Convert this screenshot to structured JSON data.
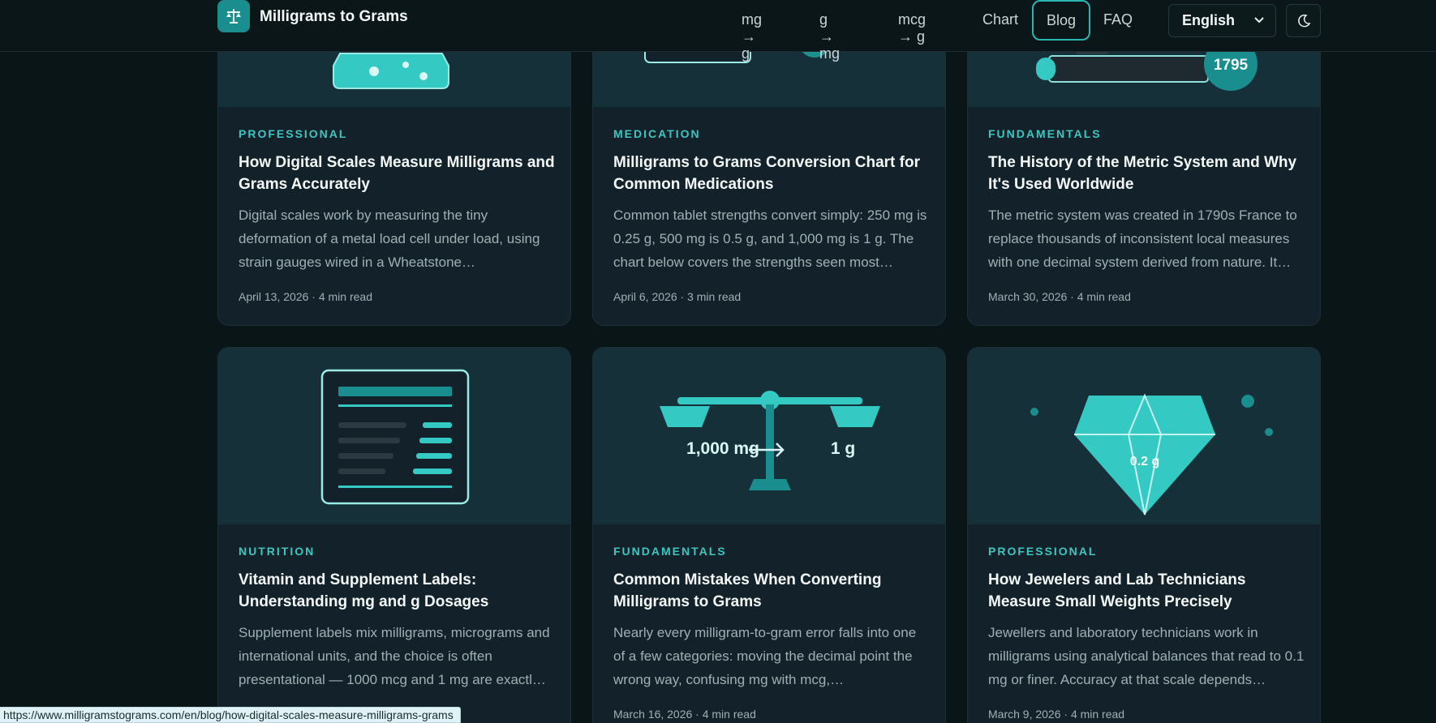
{
  "header": {
    "brand": "Milligrams to Grams",
    "nav": [
      {
        "label": "mg → g"
      },
      {
        "label": "g → mg"
      },
      {
        "label": "mcg → g"
      },
      {
        "label": "Chart"
      },
      {
        "label": "Blog"
      },
      {
        "label": "FAQ"
      }
    ],
    "language": "English",
    "logo_icon": "scale-icon",
    "theme_icon": "moon-icon"
  },
  "cards": [
    {
      "category": "PROFESSIONAL",
      "title": "How Digital Scales Measure Milligrams and Grams Accurately",
      "excerpt": "Digital scales work by measuring the tiny deformation of a metal load cell under load, using strain gauges wired in a Wheatstone…",
      "meta": "April 13, 2026 · 4 min read"
    },
    {
      "category": "MEDICATION",
      "title": "Milligrams to Grams Conversion Chart for Common Medications",
      "excerpt": "Common tablet strengths convert simply: 250 mg is 0.25 g, 500 mg is 0.5 g, and 1,000 mg is 1 g. The chart below covers the strengths seen most…",
      "meta": "April 6, 2026 · 3 min read"
    },
    {
      "category": "FUNDAMENTALS",
      "title": "The History of the Metric System and Why It's Used Worldwide",
      "excerpt": "The metric system was created in 1790s France to replace thousands of inconsistent local measures with one decimal system derived from nature. It…",
      "meta": "March 30, 2026 · 4 min read",
      "image_label": "1795"
    },
    {
      "category": "NUTRITION",
      "title": "Vitamin and Supplement Labels: Understanding mg and g Dosages",
      "excerpt": "Supplement labels mix milligrams, micrograms and international units, and the choice is often presentational — 1000 mcg and 1 mg are exactl…",
      "meta": ""
    },
    {
      "category": "FUNDAMENTALS",
      "title": "Common Mistakes When Converting Milligrams to Grams",
      "excerpt": "Nearly every milligram-to-gram error falls into one of a few categories: moving the decimal point the wrong way, confusing mg with mcg,…",
      "meta": "March 16, 2026 · 4 min read",
      "image_left": "1,000 mg",
      "image_right": "1 g"
    },
    {
      "category": "PROFESSIONAL",
      "title": "How Jewelers and Lab Technicians Measure Small Weights Precisely",
      "excerpt": "Jewellers and laboratory technicians work in milligrams using analytical balances that read to 0.1 mg or finer. Accuracy at that scale depends…",
      "meta": "March 9, 2026 · 4 min read",
      "image_label": "0.2 g"
    }
  ],
  "status_url": "https://www.milligramstograms.com/en/blog/how-digital-scales-measure-milligrams-grams",
  "colors": {
    "accent": "#3cc6c0",
    "background": "#0a1517",
    "card": "#13222a"
  }
}
